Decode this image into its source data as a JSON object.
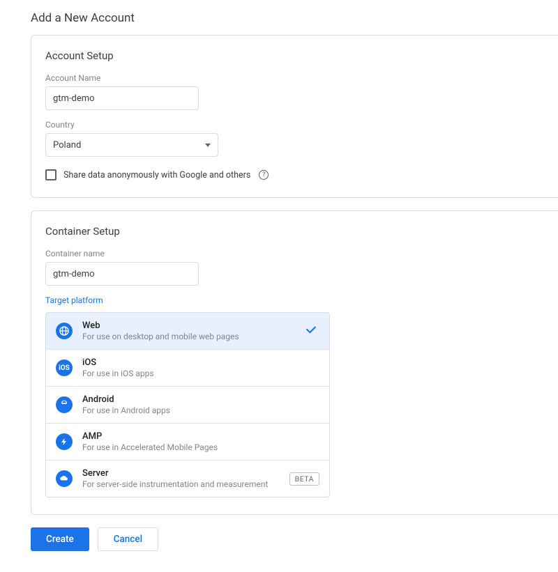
{
  "page": {
    "title": "Add a New Account"
  },
  "account": {
    "section_title": "Account Setup",
    "name_label": "Account Name",
    "name_value": "gtm-demo",
    "country_label": "Country",
    "country_value": "Poland",
    "share_label": "Share data anonymously with Google and others",
    "share_checked": false
  },
  "container": {
    "section_title": "Container Setup",
    "name_label": "Container name",
    "name_value": "gtm-demo",
    "target_label": "Target platform",
    "platforms": [
      {
        "name": "Web",
        "desc": "For use on desktop and mobile web pages",
        "icon": "globe",
        "selected": true
      },
      {
        "name": "iOS",
        "desc": "For use in iOS apps",
        "icon": "ios",
        "selected": false
      },
      {
        "name": "Android",
        "desc": "For use in Android apps",
        "icon": "android",
        "selected": false
      },
      {
        "name": "AMP",
        "desc": "For use in Accelerated Mobile Pages",
        "icon": "amp",
        "selected": false
      },
      {
        "name": "Server",
        "desc": "For server-side instrumentation and measurement",
        "icon": "server",
        "selected": false,
        "badge": "BETA"
      }
    ]
  },
  "buttons": {
    "create": "Create",
    "cancel": "Cancel"
  }
}
